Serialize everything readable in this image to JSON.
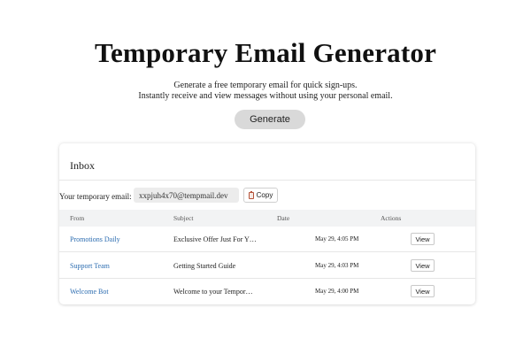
{
  "header": {
    "title": "Temporary Email Generator",
    "subtitle_line1": "Generate a free temporary email for quick sign-ups.",
    "subtitle_line2": "Instantly receive and view messages without using your personal email."
  },
  "actions": {
    "generate_label": "Generate"
  },
  "inbox": {
    "title": "Inbox",
    "email_label": "Your temporary email:",
    "email_value": "xxpjuh4x70@tempmail.dev",
    "copy_label": "Copy",
    "columns": {
      "from": "From",
      "subject": "Subject",
      "date": "Date",
      "actions": "Actions"
    },
    "messages": [
      {
        "from": "Promotions Daily",
        "subject": "Exclusive Offer Just For Y…",
        "date": "May 29, 4:05 PM",
        "action": "View"
      },
      {
        "from": "Support Team",
        "subject": "Getting Started Guide",
        "date": "May 29, 4:03 PM",
        "action": "View"
      },
      {
        "from": "Welcome Bot",
        "subject": "Welcome to your Tempor…",
        "date": "May 29, 4:00 PM",
        "action": "View"
      }
    ]
  },
  "colors": {
    "link": "#2b6cb0",
    "generate_button_bg": "#d9d9d9",
    "table_header_bg": "#f2f3f4",
    "email_box_bg": "#ececec"
  },
  "icons": {
    "copy": "clipboard-icon"
  }
}
